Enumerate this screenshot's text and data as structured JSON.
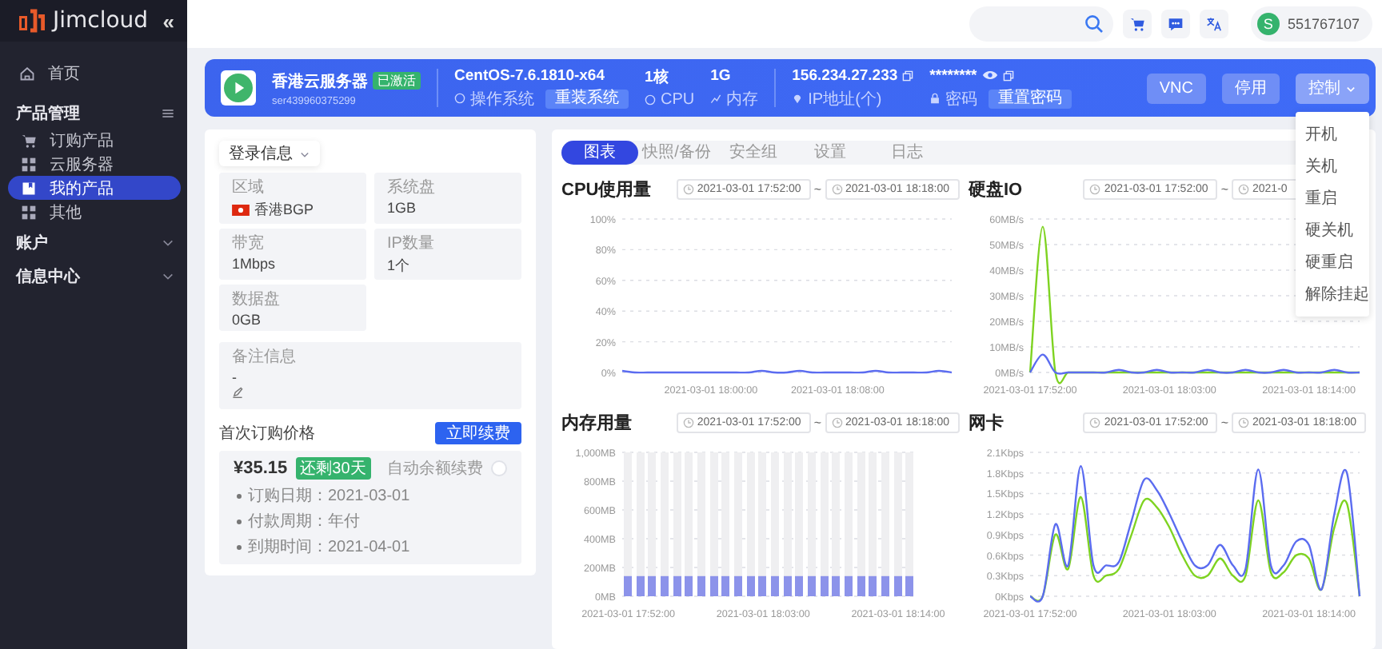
{
  "sidebar": {
    "logo": "Jimcloud",
    "collapse_glyph": "«",
    "items": [
      {
        "label": "首页",
        "kind": "link"
      },
      {
        "label": "产品管理",
        "kind": "group",
        "expanded": true,
        "children": [
          {
            "label": "订购产品",
            "selected": false
          },
          {
            "label": "云服务器",
            "selected": false
          },
          {
            "label": "我的产品",
            "selected": true
          },
          {
            "label": "其他",
            "selected": false
          }
        ]
      },
      {
        "label": "账户",
        "kind": "group",
        "expanded": false
      },
      {
        "label": "信息中心",
        "kind": "group",
        "expanded": false
      }
    ]
  },
  "header": {
    "user": {
      "avatar_letter": "S",
      "name": "551767107"
    }
  },
  "server_card": {
    "name": "香港云服务器",
    "status": "已激活",
    "id": "ser439960375299",
    "os": {
      "value": "CentOS-7.6.1810-x64",
      "label": "操作系统",
      "button": "重装系统"
    },
    "specs": [
      {
        "value": "1核",
        "label": "CPU"
      },
      {
        "value": "1G",
        "label": "内存"
      }
    ],
    "ip": {
      "value": "156.234.27.233",
      "label": "IP地址(个)"
    },
    "password": {
      "value": "********",
      "label": "密码",
      "button": "重置密码"
    },
    "actions": [
      {
        "label": "VNC",
        "kind": "button"
      },
      {
        "label": "停用",
        "kind": "button"
      },
      {
        "label": "控制",
        "kind": "dropdown",
        "expanded": true
      }
    ],
    "control_menu": [
      "开机",
      "关机",
      "重启",
      "硬关机",
      "硬重启",
      "解除挂起"
    ]
  },
  "info_panel": {
    "dropdown": "登录信息",
    "fields": [
      {
        "label": "区域",
        "value": "香港BGP",
        "kind": "region"
      },
      {
        "label": "系统盘",
        "value": "1GB",
        "kind": "text"
      },
      {
        "label": "带宽",
        "value": "1Mbps",
        "kind": "text"
      },
      {
        "label": "IP数量",
        "value": "1个",
        "kind": "text"
      },
      {
        "label": "数据盘",
        "value": "0GB",
        "kind": "text"
      }
    ],
    "remark": {
      "label": "备注信息",
      "value": "-"
    },
    "billing": {
      "title": "首次订购价格",
      "button": "立即续费",
      "price": "¥35.15",
      "badge": "还剩30天",
      "auto_renew": {
        "label": "自动余额续费",
        "on": false
      },
      "details": [
        "订购日期：2021-03-01",
        "付款周期：年付",
        "到期时间：2021-04-01"
      ]
    }
  },
  "tabs": [
    {
      "label": "图表",
      "selected": true
    },
    {
      "label": "快照/备份",
      "selected": false
    },
    {
      "label": "安全组",
      "selected": false
    },
    {
      "label": "设置",
      "selected": false
    },
    {
      "label": "日志",
      "selected": false
    }
  ],
  "charts": [
    {
      "title": "CPU使用量",
      "start": "2021-03-01 17:52:00",
      "separator": "~",
      "end": "2021-03-01 18:18:00",
      "chart_data": {
        "type": "line",
        "grid": true,
        "ylim": [
          0,
          100
        ],
        "categories": [
          null,
          null,
          null,
          null,
          null,
          null,
          null,
          "2021-03-01 18:00:00",
          null,
          null,
          null,
          null,
          null,
          null,
          null,
          null,
          null,
          "2021-03-01 18:08:00",
          null,
          null,
          null,
          null,
          null,
          null,
          null,
          null,
          null
        ],
        "yticks": [
          {
            "value": 0,
            "label": "0%"
          },
          {
            "value": 20,
            "label": "20%"
          },
          {
            "value": 40,
            "label": "40%"
          },
          {
            "value": 60,
            "label": "60%"
          },
          {
            "value": 80,
            "label": "80%"
          },
          {
            "value": 100,
            "label": "100%"
          }
        ],
        "series": [
          {
            "color": "#5b6cf0",
            "values": [
              1,
              0,
              0,
              0,
              0,
              0,
              0,
              0,
              0,
              0,
              0,
              1,
              0,
              0,
              1,
              0,
              0,
              0,
              0,
              0,
              1,
              0,
              0,
              0,
              0,
              1,
              0
            ]
          }
        ]
      }
    },
    {
      "title": "硬盘IO",
      "start": "2021-03-01 17:52:00",
      "separator": "~",
      "end": "2021-0",
      "chart_data": {
        "type": "line",
        "grid": true,
        "ylim": [
          0,
          60
        ],
        "categories": [
          "2021-03-01 17:52:00",
          null,
          null,
          null,
          null,
          null,
          null,
          null,
          null,
          null,
          null,
          "2021-03-01 18:03:00",
          null,
          null,
          null,
          null,
          null,
          null,
          null,
          null,
          null,
          null,
          "2021-03-01 18:14:00",
          null,
          null,
          null,
          null
        ],
        "yticks": [
          {
            "value": 0,
            "label": "0MB/s"
          },
          {
            "value": 10,
            "label": "10MB/s"
          },
          {
            "value": 20,
            "label": "20MB/s"
          },
          {
            "value": 30,
            "label": "30MB/s"
          },
          {
            "value": 40,
            "label": "40MB/s"
          },
          {
            "value": 50,
            "label": "50MB/s"
          },
          {
            "value": 60,
            "label": "60MB/s"
          }
        ],
        "series": [
          {
            "color": "#7ed321",
            "values": [
              0,
              57,
              0,
              0,
              0,
              0,
              0,
              0,
              0,
              0,
              0,
              0,
              0,
              0,
              0,
              0,
              0,
              0,
              0,
              0,
              0,
              0,
              0,
              0,
              0,
              0,
              0
            ]
          },
          {
            "color": "#5b6cf0",
            "values": [
              0,
              7,
              0,
              0,
              0,
              0,
              0,
              1,
              0,
              0,
              1,
              0,
              0,
              0,
              1,
              0,
              0,
              1,
              0,
              0,
              1,
              0,
              0,
              0,
              1,
              0,
              0
            ]
          }
        ]
      }
    },
    {
      "title": "内存用量",
      "start": "2021-03-01 17:52:00",
      "separator": "~",
      "end": "2021-03-01 18:18:00",
      "chart_data": {
        "type": "bar",
        "grid": true,
        "ylim": [
          0,
          1000
        ],
        "categories": [
          "2021-03-01 17:52:00",
          null,
          null,
          null,
          null,
          null,
          null,
          null,
          null,
          null,
          null,
          "2021-03-01 18:03:00",
          null,
          null,
          null,
          null,
          null,
          null,
          null,
          null,
          null,
          null,
          "2021-03-01 18:14:00",
          null
        ],
        "yticks": [
          {
            "value": 0,
            "label": "0MB"
          },
          {
            "value": 200,
            "label": "200MB"
          },
          {
            "value": 400,
            "label": "400MB"
          },
          {
            "value": 600,
            "label": "600MB"
          },
          {
            "value": 800,
            "label": "800MB"
          },
          {
            "value": 1000,
            "label": "1,000MB"
          }
        ],
        "series": [
          {
            "color": "#8c93ea",
            "values": [
              140,
              140,
              140,
              140,
              140,
              140,
              140,
              140,
              140,
              140,
              140,
              140,
              140,
              140,
              140,
              140,
              140,
              140,
              140,
              140,
              140,
              140,
              140,
              140
            ]
          }
        ]
      }
    },
    {
      "title": "网卡",
      "start": "2021-03-01 17:52:00",
      "separator": "~",
      "end": "2021-03-01 18:18:00",
      "chart_data": {
        "type": "line",
        "grid": true,
        "ylim": [
          0,
          2.1
        ],
        "categories": [
          "2021-03-01 17:52:00",
          null,
          null,
          null,
          null,
          null,
          null,
          null,
          null,
          null,
          null,
          "2021-03-01 18:03:00",
          null,
          null,
          null,
          null,
          null,
          null,
          null,
          null,
          null,
          null,
          "2021-03-01 18:14:00",
          null,
          null,
          null,
          null
        ],
        "yticks": [
          {
            "value": 0,
            "label": "0Kbps"
          },
          {
            "value": 0.3,
            "label": "0.3Kbps"
          },
          {
            "value": 0.6,
            "label": "0.6Kbps"
          },
          {
            "value": 0.9,
            "label": "0.9Kbps"
          },
          {
            "value": 1.2,
            "label": "1.2Kbps"
          },
          {
            "value": 1.5,
            "label": "1.5Kbps"
          },
          {
            "value": 1.8,
            "label": "1.8Kbps"
          },
          {
            "value": 2.1,
            "label": "2.1Kbps"
          }
        ],
        "series": [
          {
            "color": "#7ed321",
            "values": [
              0,
              0,
              0.9,
              0.4,
              1.45,
              0.3,
              0.3,
              0.4,
              0.9,
              1.4,
              1.3,
              1.0,
              0.6,
              0.3,
              0.3,
              0.55,
              0.3,
              0.3,
              1.4,
              0.35,
              0.35,
              0.6,
              0.55,
              0.1,
              1.0,
              1.35,
              0
            ]
          },
          {
            "color": "#5b6cf0",
            "values": [
              0,
              0,
              1.05,
              0.45,
              1.9,
              0.45,
              0.45,
              0.5,
              1.1,
              1.7,
              1.55,
              1.2,
              0.8,
              0.45,
              0.45,
              0.75,
              0.45,
              0.4,
              1.85,
              0.45,
              0.45,
              0.8,
              0.75,
              0.1,
              1.2,
              1.8,
              0
            ]
          }
        ]
      }
    }
  ]
}
